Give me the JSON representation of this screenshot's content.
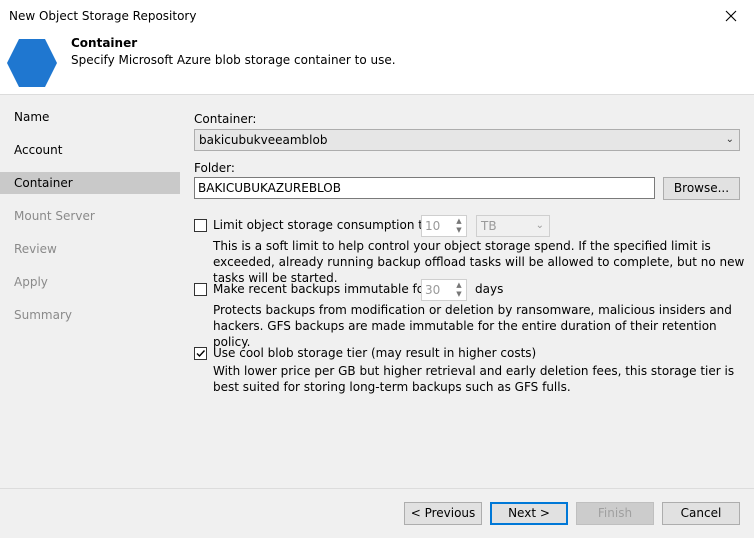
{
  "window": {
    "title": "New Object Storage Repository"
  },
  "header": {
    "title": "Container",
    "subtitle": "Specify Microsoft Azure blob storage container to use."
  },
  "sidebar": {
    "items": [
      {
        "label": "Name"
      },
      {
        "label": "Account"
      },
      {
        "label": "Container"
      },
      {
        "label": "Mount Server"
      },
      {
        "label": "Review"
      },
      {
        "label": "Apply"
      },
      {
        "label": "Summary"
      }
    ]
  },
  "container": {
    "label": "Container:",
    "value": "bakicubukveeamblob"
  },
  "folder": {
    "label": "Folder:",
    "value": "BAKICUBUKAZUREBLOB",
    "browse_label": "Browse..."
  },
  "limit": {
    "label": "Limit object storage consumption to:",
    "value": "10",
    "unit": "TB",
    "checked": false,
    "description": "This is a soft limit to help control your object storage spend. If the specified limit is exceeded, already running backup offload tasks will be allowed to complete, but no new tasks will be started."
  },
  "immutable": {
    "label": "Make recent backups immutable for:",
    "value": "30",
    "unit": "days",
    "checked": false,
    "description": "Protects backups from modification or deletion by ransomware, malicious insiders and hackers. GFS backups are made immutable for the entire duration of their retention policy."
  },
  "cool_tier": {
    "label": "Use cool blob storage tier (may result in higher costs)",
    "checked": true,
    "description": "With lower price per GB but higher retrieval and early deletion fees, this storage tier is best suited for storing long-term backups such as GFS fulls."
  },
  "footer": {
    "previous_label": "< Previous",
    "next_label": "Next >",
    "finish_label": "Finish",
    "cancel_label": "Cancel"
  },
  "colors": {
    "accent": "#0078d7",
    "hexagon": "#1f77d0"
  },
  "icons": {
    "close": "close-icon",
    "header": "hexagon-icon",
    "dropdown": "chevron-down-icon"
  }
}
